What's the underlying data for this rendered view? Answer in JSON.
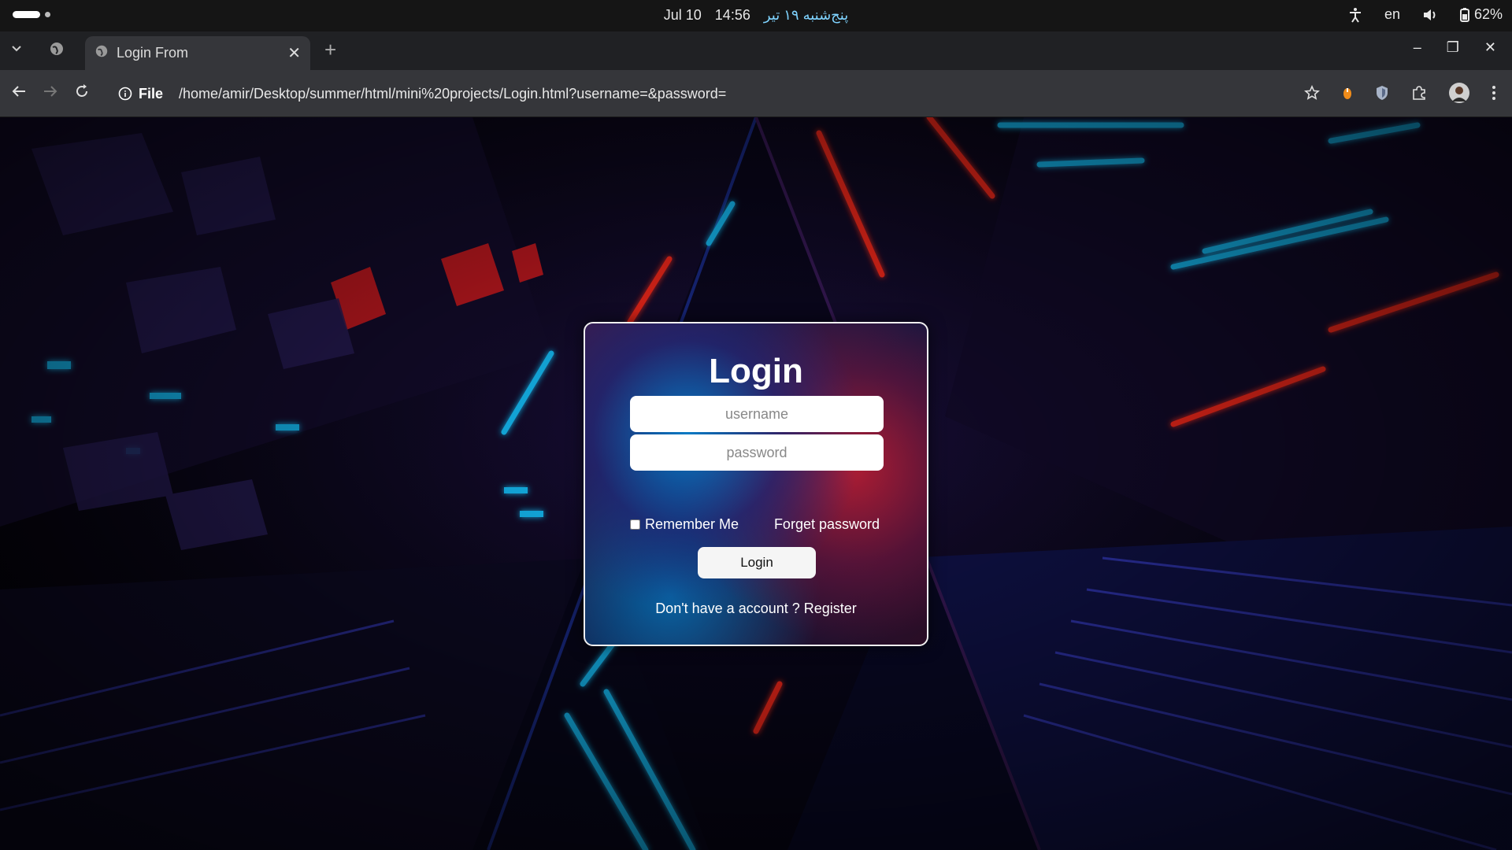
{
  "system_bar": {
    "date": "Jul 10",
    "time": "14:56",
    "persian_date": "پنج‌شنبه ۱۹ تیر",
    "language": "en",
    "battery": "62%"
  },
  "browser": {
    "tab_title": "Login From",
    "omnibox_chip": "File",
    "url": "/home/amir/Desktop/summer/html/mini%20projects/Login.html?username=&password="
  },
  "login_form": {
    "title": "Login",
    "username_placeholder": "username",
    "password_placeholder": "password",
    "remember_label": "Remember Me",
    "forget_label": "Forget password",
    "submit_label": "Login",
    "register_prompt": "Don't have a account ?",
    "register_link": "Register"
  },
  "colors": {
    "accent_blue": "#19c3ff",
    "accent_red": "#ff2a1a",
    "background": "#0a0618"
  }
}
